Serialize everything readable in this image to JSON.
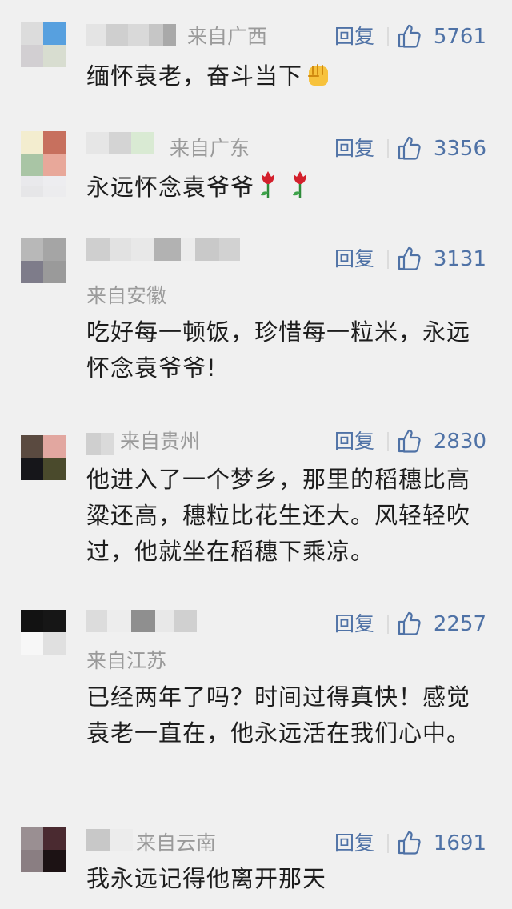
{
  "reply_label": "回复",
  "colors": {
    "link": "#4f72a6",
    "meta": "#9a9a9a",
    "text": "#1d1d1d",
    "background": "#f0f0f0"
  },
  "comments": [
    {
      "location": "来自广西",
      "likes": "5761",
      "text": "缅怀袁老，奋斗当下",
      "emoji": [
        "raised-fist-emoji"
      ]
    },
    {
      "location": "来自广东",
      "likes": "3356",
      "text": "永远怀念袁爷爷",
      "emoji": [
        "rose-emoji",
        "rose-emoji"
      ]
    },
    {
      "location": "来自安徽",
      "likes": "3131",
      "text": "吃好每一顿饭，珍惜每一粒米，永远怀念袁爷爷!"
    },
    {
      "location": "来自贵州",
      "likes": "2830",
      "text": "他进入了一个梦乡，那里的稻穗比高粱还高，穗粒比花生还大。风轻轻吹过，他就坐在稻穗下乘凉。"
    },
    {
      "location": "来自江苏",
      "likes": "2257",
      "text": "已经两年了吗？时间过得真快！感觉袁老一直在，他永远活在我们心中。"
    },
    {
      "location": "来自云南",
      "likes": "1691",
      "text": "我永远记得他离开那天"
    }
  ]
}
